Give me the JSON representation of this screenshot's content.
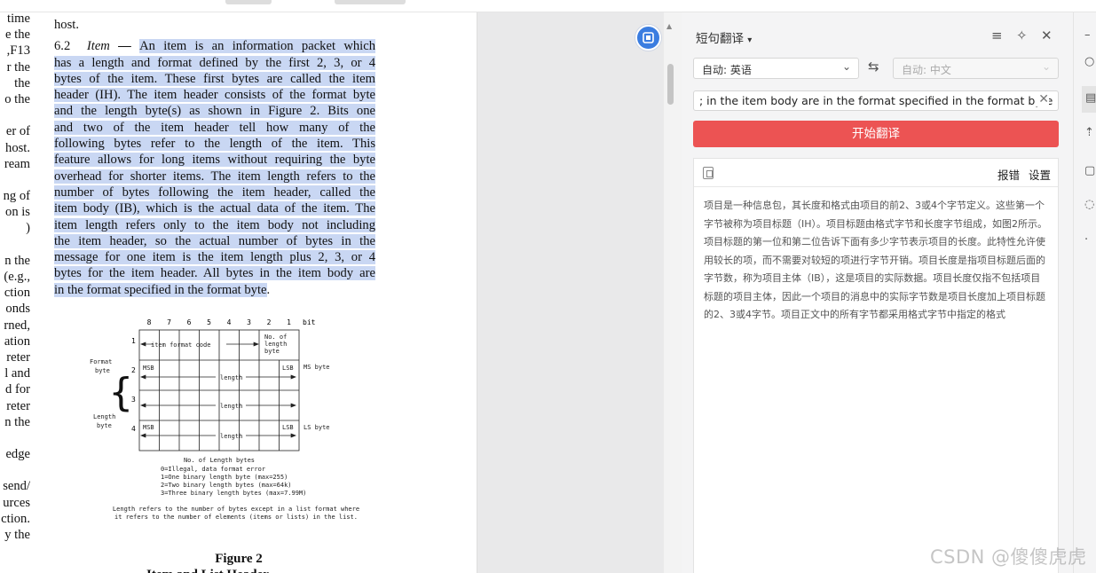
{
  "document": {
    "left_column_fragments": [
      "time",
      "e the",
      ",F13",
      "r the",
      "the",
      "o the",
      "",
      "er of",
      "host.",
      "ream",
      "",
      "ng of",
      "on is",
      ")",
      "",
      "n the",
      "(e.g.,",
      "ction",
      "onds",
      "rned,",
      "ation",
      "reter",
      "l and",
      "d for",
      "reter",
      "n the",
      "",
      "edge",
      "",
      "send/",
      "urces",
      "ction.",
      "y the"
    ],
    "host_line": "host.",
    "section_number": "6.2",
    "section_heading": "Item",
    "section_dash": " — ",
    "paragraph_lines": [
      "An item is an information packet which",
      "has a length and format defined by the first 2, 3, or 4",
      "bytes of the item. These first bytes are called the item",
      "header (IH). The item header consists of the format byte",
      "and the length byte(s) as shown in Figure 2. Bits one",
      "and two of the item header tell how many of the",
      "following bytes refer to the length of the item. This",
      "feature allows for long items without requiring the byte",
      "overhead for shorter items. The item length refers to the",
      "number of bytes following the item header, called the",
      "item body (IB), which is the actual data of the item. The",
      "item length refers only to the item body not including",
      "the item header, so the actual number of bytes in the",
      "message for one item is the item length plus 2, 3, or 4",
      "bytes for the item header. All bytes in the item body are",
      "in the format specified in the format byte"
    ],
    "paragraph_end": ".",
    "figure": {
      "bit_numbers": [
        "8",
        "7",
        "6",
        "5",
        "4",
        "3",
        "2",
        "1"
      ],
      "bit_label": "bit",
      "rows": [
        "1",
        "2",
        "3",
        "4"
      ],
      "item_format_code": "item format code",
      "no_of_length_byte": [
        "No. of",
        "length",
        "byte"
      ],
      "msb": "MSB",
      "lsb": "LSB",
      "length": "length",
      "ms_byte": "MS byte",
      "ls_byte": "LS byte",
      "format_byte": [
        "Format",
        "byte"
      ],
      "length_byte": [
        "Length",
        "byte"
      ],
      "notes_title": "No. of Length bytes",
      "notes": [
        "0=Illegal, data format error",
        "1=One binary length byte (max=255)",
        "2=Two binary length bytes (max=64k)",
        "3=Three binary length bytes (max=7.99M)"
      ],
      "footnote": [
        "Length refers to the number of bytes except in a list format where",
        "it refers to the number of elements (items or lists) in the list."
      ]
    },
    "figure_caption": "Figure 2",
    "figure_subtitle": "Item and List Header"
  },
  "translator": {
    "title": "短句翻译",
    "title_caret": "▾",
    "source_lang": "自动: 英语",
    "target_lang": "自动: 中文",
    "swap_icon": "⇆",
    "input_value": "; in the item body are in the format specified in the format byte",
    "translate_button": "开始翻译",
    "report_error": "报错",
    "settings": "设置",
    "result_text": "项目是一种信息包，其长度和格式由项目的前2、3或4个字节定义。这些第一个字节被称为项目标题（IH）。项目标题由格式字节和长度字节组成，如图2所示。项目标题的第一位和第二位告诉下面有多少字节表示项目的长度。此特性允许使用较长的项，而不需要对较短的项进行字节开销。项目长度是指项目标题后面的字节数，称为项目主体（IB），这是项目的实际数据。项目长度仅指不包括项目标题的项目主体，因此一个项目的消息中的实际字节数是项目长度加上项目标题的2、3或4字节。项目正文中的所有字节都采用格式字节中指定的格式"
  },
  "watermark": "CSDN @傻傻虎虎",
  "colors": {
    "highlight": "#c9d7f3",
    "translate_button": "#ec5353",
    "plugin_blue": "#3b7de0"
  }
}
